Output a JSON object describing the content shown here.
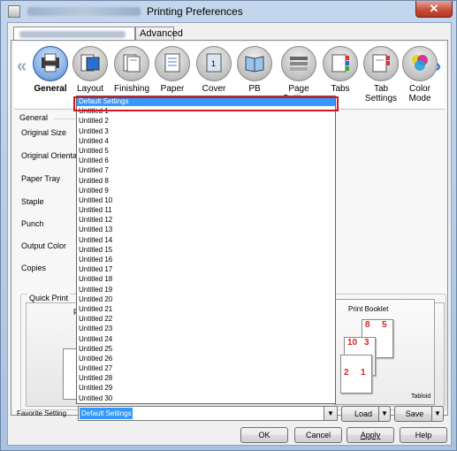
{
  "window": {
    "title": "Printing Preferences",
    "close_glyph": "✕"
  },
  "tabs": {
    "advanced_label": "Advanced"
  },
  "toolbar": {
    "left_arrow": "«",
    "right_arrow": "»",
    "items": [
      {
        "label": "General",
        "icon": "general-icon"
      },
      {
        "label": "Layout",
        "icon": "layout-icon"
      },
      {
        "label": "Finishing",
        "icon": "finishing-icon"
      },
      {
        "label": "Paper",
        "icon": "paper-icon"
      },
      {
        "label": "Cover",
        "icon": "cover-icon"
      },
      {
        "label": "PB",
        "icon": "pb-icon"
      },
      {
        "label": "Page Settings",
        "icon": "page-settings-icon"
      },
      {
        "label": "Tabs",
        "icon": "tabs-icon"
      },
      {
        "label": "Tab Settings",
        "icon": "tab-settings-icon"
      },
      {
        "label": "Color Mode",
        "icon": "color-mode-icon"
      }
    ]
  },
  "general": {
    "group_label": "General",
    "fields": {
      "original_size": "Original Size",
      "original_orientation": "Original Orientatio",
      "paper_tray": "Paper Tray",
      "staple": "Staple",
      "punch": "Punch",
      "output_color": "Output Color",
      "copies": "Copies"
    }
  },
  "quick_print": {
    "label": "Quick Print",
    "partial_label": "P",
    "print_booklet": "Print Booklet",
    "tabloid": "Tabloid",
    "page_numbers": [
      "8",
      "5",
      "10",
      "3",
      "2",
      "1"
    ]
  },
  "favorite": {
    "label": "Favorite Setting",
    "selected": "Default Settings",
    "options": [
      "Default Settings",
      "Untitled 1",
      "Untitled 2",
      "Untitled 3",
      "Untitled 4",
      "Untitled 5",
      "Untitled 6",
      "Untitled 7",
      "Untitled 8",
      "Untitled 9",
      "Untitled 10",
      "Untitled 11",
      "Untitled 12",
      "Untitled 13",
      "Untitled 14",
      "Untitled 15",
      "Untitled 16",
      "Untitled 17",
      "Untitled 18",
      "Untitled 19",
      "Untitled 20",
      "Untitled 21",
      "Untitled 22",
      "Untitled 23",
      "Untitled 24",
      "Untitled 25",
      "Untitled 26",
      "Untitled 27",
      "Untitled 28",
      "Untitled 29",
      "Untitled 30"
    ],
    "load_label": "Load",
    "save_label": "Save"
  },
  "buttons": {
    "ok": "OK",
    "cancel": "Cancel",
    "apply": "Apply",
    "help": "Help"
  },
  "colors": {
    "selection": "#3399ff",
    "highlight_box": "#d6141e",
    "toolbar_selected": "#3b6fb8",
    "next_arrow": "#1f6fd6"
  }
}
